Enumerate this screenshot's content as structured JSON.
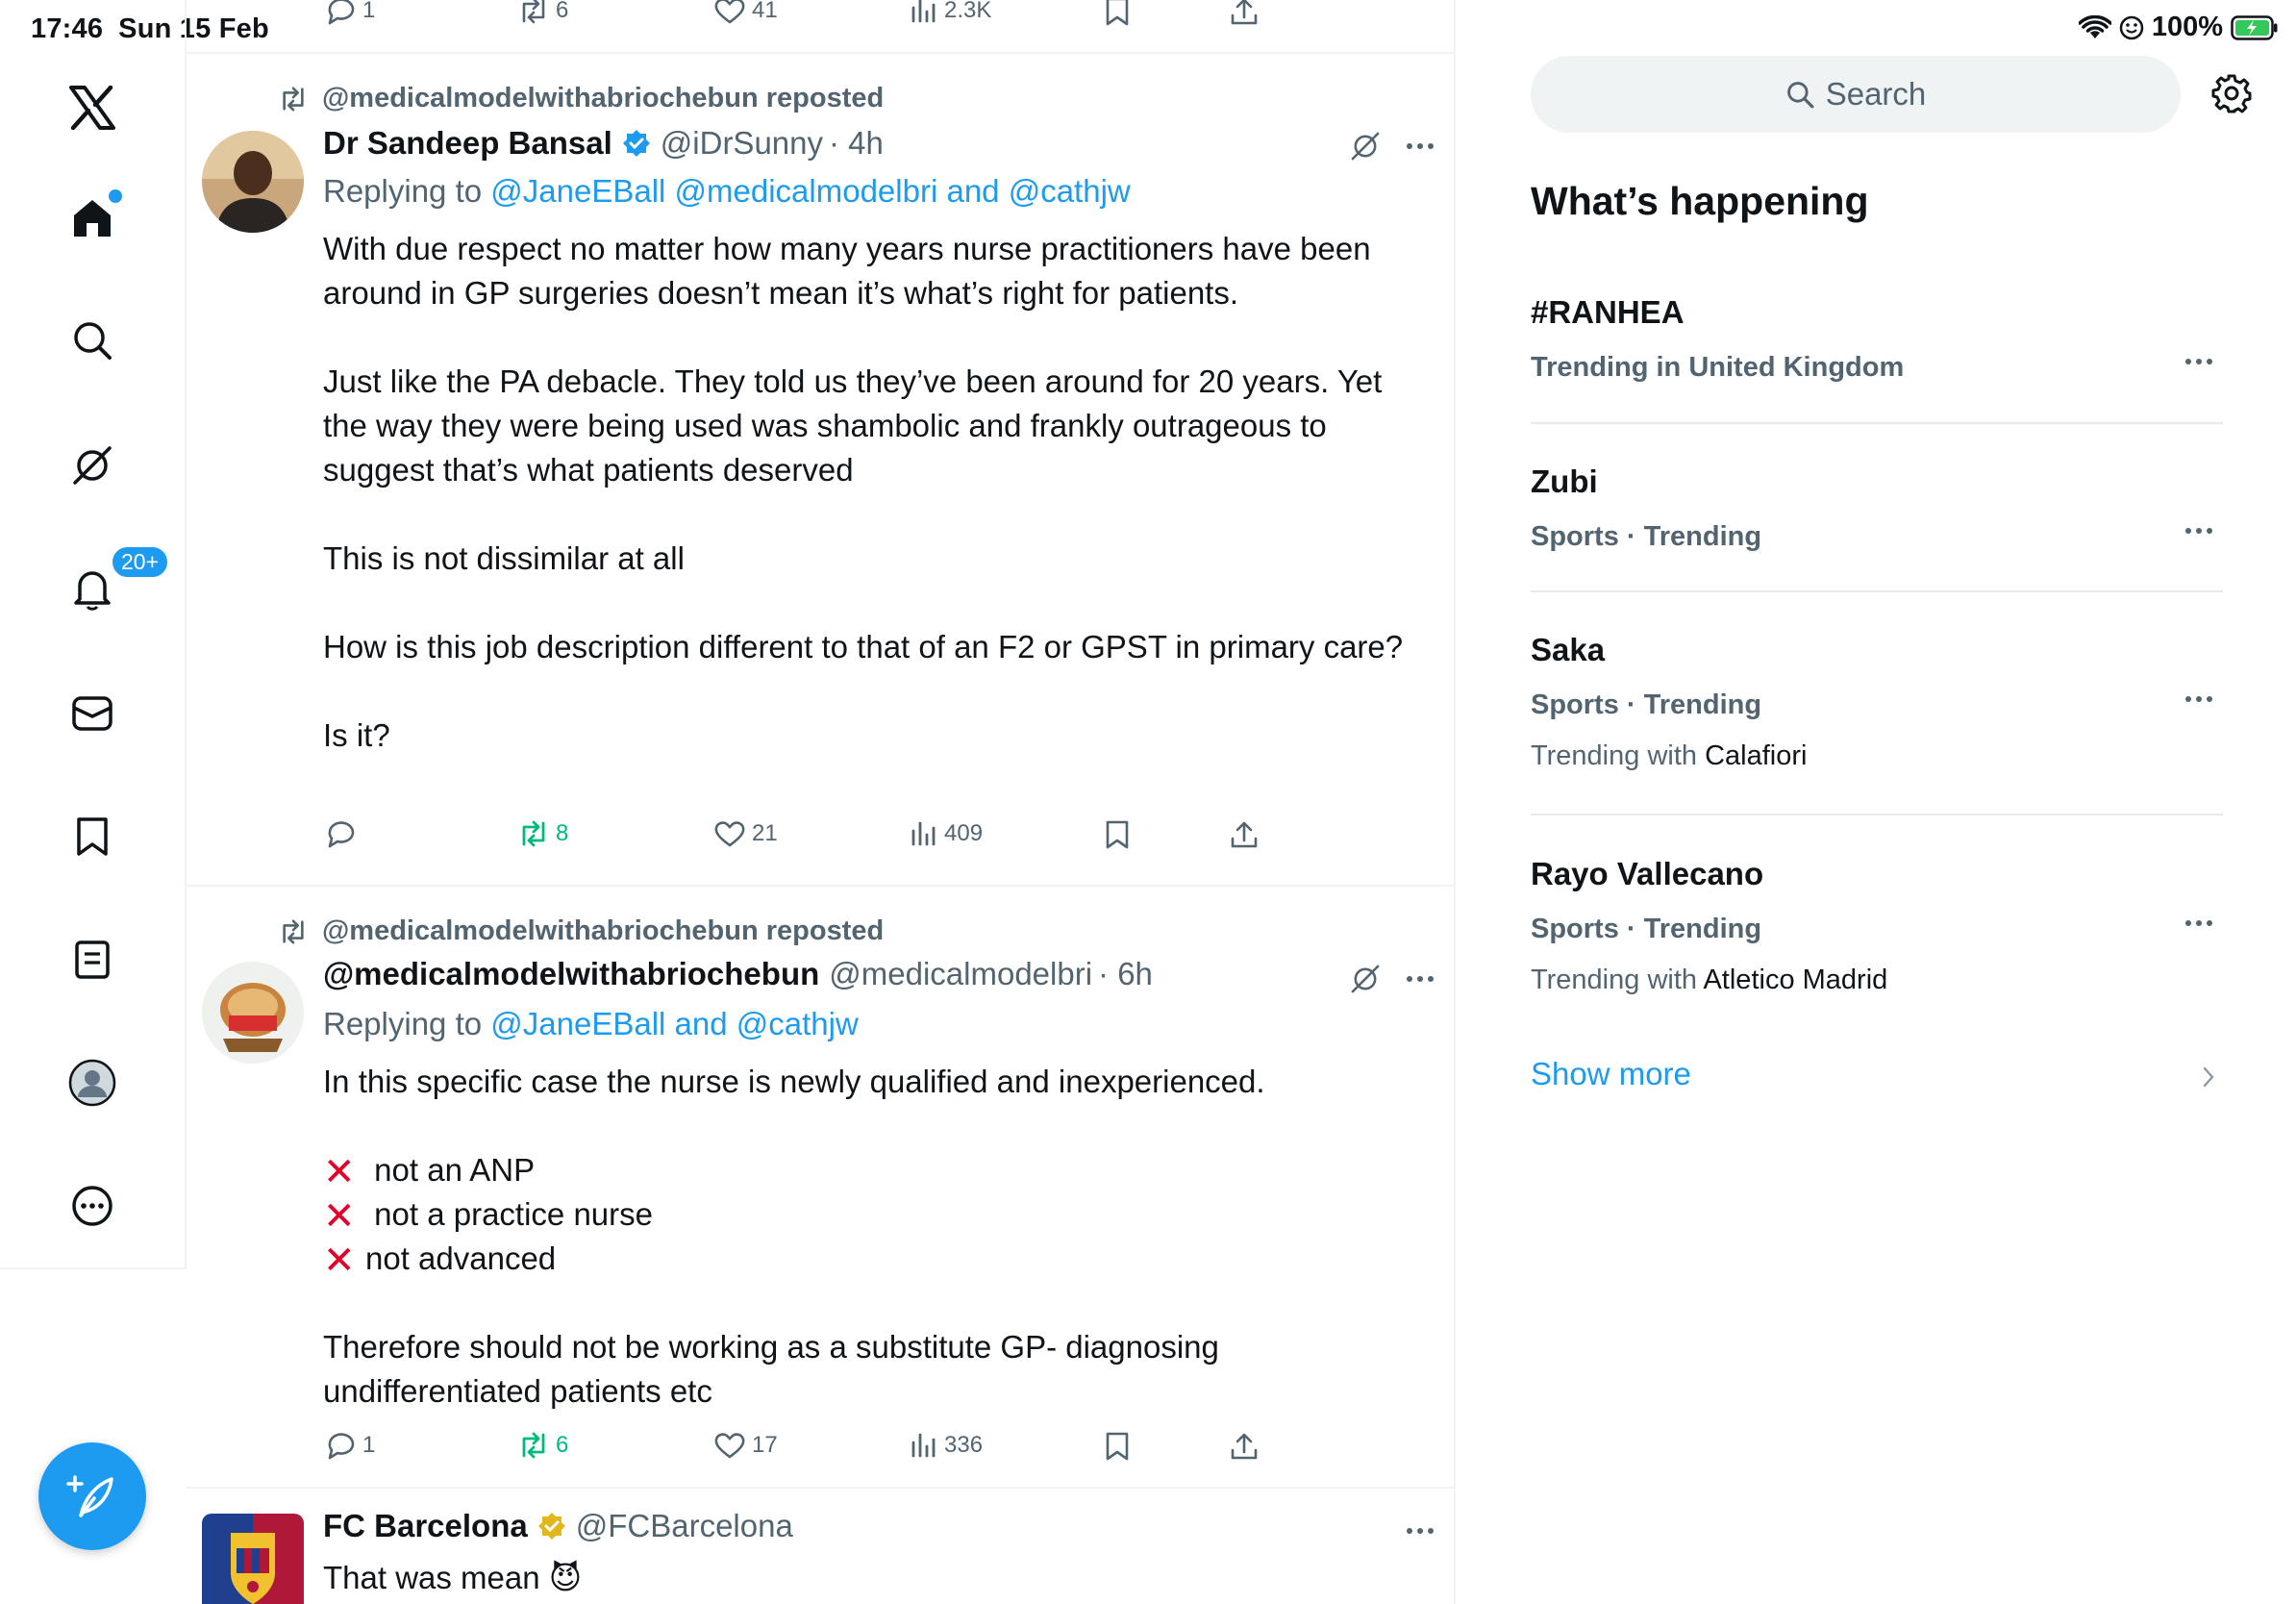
{
  "status_bar": {
    "time": "17:46",
    "date": "Sun 15 Feb",
    "battery": "100%"
  },
  "nav": {
    "notifications_badge": "20+"
  },
  "feed": {
    "top_stats": {
      "replies": "1",
      "reposts": "6",
      "likes": "41",
      "views": "2.3K"
    },
    "posts": [
      {
        "repost_label": "@medicalmodelwithabriochebun reposted",
        "name": "Dr Sandeep Bansal",
        "handle": "@iDrSunny",
        "time": "· 4h",
        "replying_prefix": "Replying to ",
        "replying_to": "@JaneEBall @medicalmodelbri and @cathjw",
        "text": [
          "With due respect no matter how many years nurse practitioners have been around in GP surgeries doesn’t mean it’s what’s right for patients.",
          "Just like the PA debacle. They told us they’ve been around for 20 years. Yet the way they were being used was shambolic and frankly outrageous to suggest that’s what patients deserved",
          "This is not dissimilar at all",
          "How is this job description different to that of an F2 or GPST in primary care?",
          "Is it?"
        ],
        "stats": {
          "replies": "",
          "reposts": "8",
          "likes": "21",
          "views": "409"
        }
      },
      {
        "repost_label": "@medicalmodelwithabriochebun reposted",
        "name": "@medicalmodelwithabriochebun",
        "handle": "@medicalmodelbri",
        "time": "· 6h",
        "replying_prefix": "Replying to ",
        "replying_to": "@JaneEBall and @cathjw",
        "text_intro": "In this specific case  the nurse is newly qualified and inexperienced.",
        "x_lines": [
          "not an ANP",
          "not a practice nurse",
          "not advanced"
        ],
        "text_outro": "Therefore should not be working as a substitute GP- diagnosing undifferentiated patients etc",
        "stats": {
          "replies": "1",
          "reposts": "6",
          "likes": "17",
          "views": "336"
        }
      },
      {
        "name": "FC Barcelona",
        "handle": "@FCBarcelona",
        "text": "That was mean 😈"
      }
    ]
  },
  "sidebar": {
    "search_placeholder": "Search",
    "title": "What’s happening",
    "trends": [
      {
        "topic": "#RANHEA",
        "context": "Trending in United Kingdom"
      },
      {
        "topic": "Zubi",
        "context": "Sports · Trending"
      },
      {
        "topic": "Saka",
        "context": "Sports · Trending",
        "with_prefix": "Trending with ",
        "with": "Calafiori"
      },
      {
        "topic": "Rayo Vallecano",
        "context": "Sports · Trending",
        "with_prefix": "Trending with ",
        "with": "Atletico Madrid"
      }
    ],
    "show_more": "Show more"
  }
}
